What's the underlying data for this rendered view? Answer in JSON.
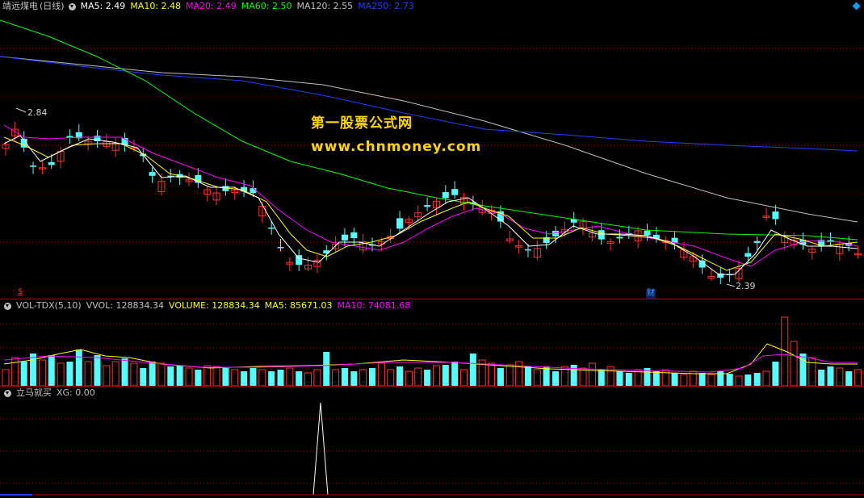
{
  "main": {
    "title": "靖远煤电",
    "period": "(日线)",
    "ma": [
      {
        "label": "MA5: 2.49",
        "color": "#ffffff"
      },
      {
        "label": "MA10: 2.48",
        "color": "#ffff00"
      },
      {
        "label": "MA20: 2.49",
        "color": "#ff00ff"
      },
      {
        "label": "MA60: 2.50",
        "color": "#00ff00"
      },
      {
        "label": "MA120: 2.55",
        "color": "#c0c0c0"
      },
      {
        "label": "MA250: 2.73",
        "color": "#2040ff"
      }
    ],
    "high_label": "2.84",
    "low_label": "2.39",
    "event_badge": "财",
    "left_marker": "$",
    "watermark_line1": "第一股票公式网",
    "watermark_line2": "www.chnmoney.com"
  },
  "volume": {
    "title": "VOL-TDX(5,10)",
    "items": [
      {
        "label": "VVOL: 128834.34",
        "color": "#c0c0c0"
      },
      {
        "label": "VOLUME: 128834.34",
        "color": "#ffff00"
      },
      {
        "label": "MA5: 85671.03",
        "color": "#ffff00"
      },
      {
        "label": "MA10: 74081.68",
        "color": "#ff00ff"
      }
    ]
  },
  "indicator": {
    "title": "立马就买",
    "items": [
      {
        "label": "XG: 0.00",
        "color": "#c0c0c0"
      }
    ]
  },
  "colors": {
    "up": "#ff3030",
    "down": "#54ffff",
    "ma5": "#ffffff",
    "ma10": "#ffff00",
    "ma20": "#ff00ff",
    "ma60": "#00ff00",
    "ma120": "#c0c0c0",
    "ma250": "#2040ff"
  }
}
